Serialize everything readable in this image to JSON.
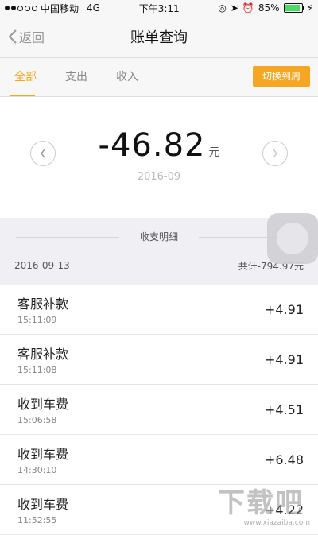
{
  "status": {
    "carrier": "中国移动",
    "network": "4G",
    "time": "下午3:11",
    "battery": "85%",
    "battery_level": 0.85
  },
  "nav": {
    "back_label": "返回",
    "title": "账单查询"
  },
  "tabs": [
    {
      "label": "全部"
    },
    {
      "label": "支出"
    },
    {
      "label": "收入"
    }
  ],
  "switch_label": "切换到周",
  "summary": {
    "amount": "-46.82",
    "unit": "元",
    "period": "2016-09"
  },
  "section": {
    "title": "收支明细",
    "date": "2016-09-13",
    "total": "共计-794.97元"
  },
  "items": [
    {
      "name": "客服补款",
      "time": "15:11:09",
      "amount": "+4.91"
    },
    {
      "name": "客服补款",
      "time": "15:11:08",
      "amount": "+4.91"
    },
    {
      "name": "收到车费",
      "time": "15:06:58",
      "amount": "+4.51"
    },
    {
      "name": "收到车费",
      "time": "14:30:10",
      "amount": "+6.48"
    },
    {
      "name": "收到车费",
      "time": "11:52:55",
      "amount": "+4.22"
    }
  ],
  "watermark": {
    "text": "下载吧",
    "domain": "www.xiazaiba.com"
  },
  "colors": {
    "accent": "#f5a623"
  }
}
